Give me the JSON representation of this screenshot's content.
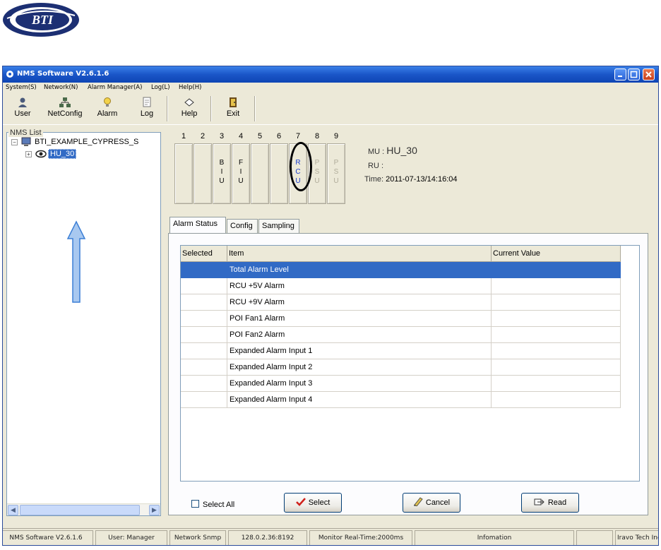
{
  "logo": {
    "text": "BTI"
  },
  "window": {
    "title": "NMS Software V2.6.1.6"
  },
  "menu": [
    "System(S)",
    "Network(N)",
    "Alarm Manager(A)",
    "Log(L)",
    "Help(H)"
  ],
  "toolbar": {
    "user": "User",
    "netconfig": "NetConfig",
    "alarm": "Alarm",
    "log": "Log",
    "help": "Help",
    "exit": "Exit"
  },
  "tree": {
    "label": "NMS List",
    "root": "BTI_EXAMPLE_CYPRESS_S",
    "child": "HU_30"
  },
  "slots": {
    "numbers": [
      "1",
      "2",
      "3",
      "4",
      "5",
      "6",
      "7",
      "8",
      "9"
    ],
    "labels": {
      "s3": "B I U",
      "s4": "F I U",
      "s7": "R C U",
      "s8": "P S U",
      "s9": "P S U"
    }
  },
  "info": {
    "mu_label": "MU :",
    "mu_value": "HU_30",
    "ru_label": "RU :",
    "time_label": "Time:",
    "time_value": "2011-07-13/14:16:04"
  },
  "tabs": [
    "Alarm Status",
    "Config",
    "Sampling"
  ],
  "table": {
    "columns": [
      "Selected",
      "Item",
      "Current Value"
    ],
    "rows": [
      {
        "item": "Total Alarm Level",
        "value": "",
        "selected": true
      },
      {
        "item": "RCU +5V Alarm",
        "value": ""
      },
      {
        "item": "RCU +9V Alarm",
        "value": ""
      },
      {
        "item": "POI Fan1 Alarm",
        "value": ""
      },
      {
        "item": "POI Fan2 Alarm",
        "value": ""
      },
      {
        "item": "Expanded Alarm Input 1",
        "value": ""
      },
      {
        "item": "Expanded Alarm Input 2",
        "value": ""
      },
      {
        "item": "Expanded Alarm Input 3",
        "value": ""
      },
      {
        "item": "Expanded Alarm Input 4",
        "value": ""
      }
    ]
  },
  "actions": {
    "select_all": "Select All",
    "select": "Select",
    "cancel": "Cancel",
    "read": "Read"
  },
  "status": [
    "NMS Software V2.6.1.6",
    "User: Manager",
    "Network Snmp",
    "128.0.2.36:8192",
    "Monitor Real-Time:2000ms",
    "Infomation",
    "",
    "Iravo Tech Inc"
  ],
  "colors": {
    "selection": "#316ac5",
    "titlebar": "#1a56c8",
    "annotation_arrow": "#3b7fd6"
  }
}
